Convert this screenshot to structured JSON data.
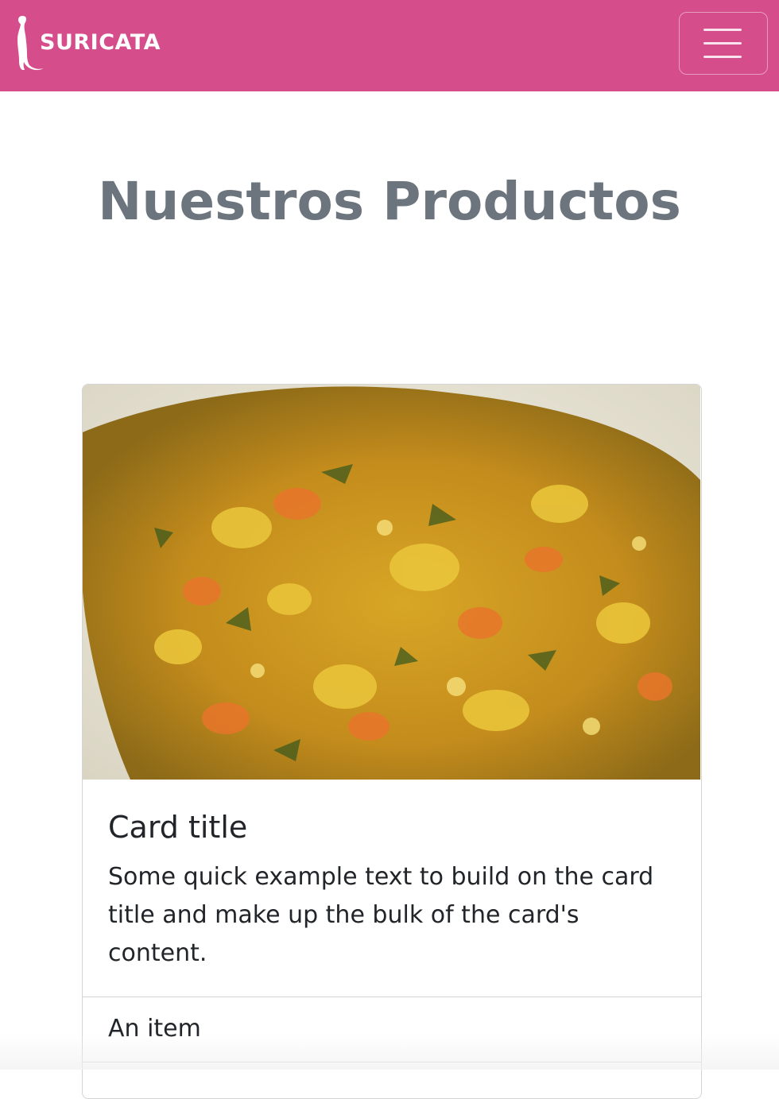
{
  "navbar": {
    "brand_text": "SURICATA",
    "brand_color": "#d54d8a",
    "logo_icon": "meerkat-icon",
    "toggler_icon": "hamburger-menu-icon"
  },
  "main": {
    "heading": "Nuestros Productos"
  },
  "card": {
    "image_desc": "bowl of vegetable stew",
    "title": "Card title",
    "text": "Some quick example text to build on the card title and make up the bulk of the card's content.",
    "list_items": [
      "An item",
      ""
    ]
  }
}
